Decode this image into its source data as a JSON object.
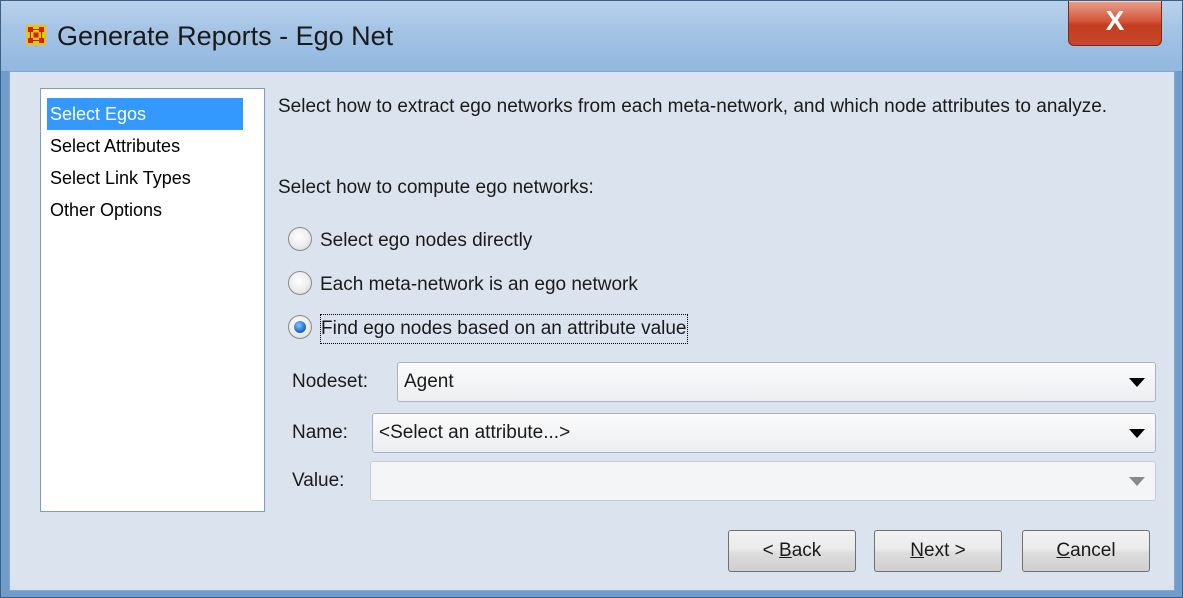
{
  "window": {
    "title": "Generate Reports - Ego Net",
    "close_label": "X",
    "icon": "network-grid-icon"
  },
  "nav": {
    "items": [
      {
        "label": "Select Egos",
        "selected": true
      },
      {
        "label": "Select Attributes",
        "selected": false
      },
      {
        "label": "Select Link Types",
        "selected": false
      },
      {
        "label": "Other Options",
        "selected": false
      }
    ]
  },
  "content": {
    "intro": "Select how to extract ego networks from each meta-network, and which node attributes to analyze.",
    "compute_label": "Select how to compute ego networks:",
    "options": [
      {
        "label": "Select ego nodes directly",
        "checked": false
      },
      {
        "label": "Each meta-network is an ego network",
        "checked": false
      },
      {
        "label": "Find ego nodes based on an attribute value",
        "checked": true
      }
    ],
    "nodeset": {
      "label": "Nodeset:",
      "value": "Agent"
    },
    "name": {
      "label": "Name:",
      "value": "<Select an attribute...>"
    },
    "value": {
      "label": "Value:",
      "value": ""
    }
  },
  "buttons": {
    "back": {
      "prefix": "< ",
      "mnemonic": "B",
      "rest": "ack"
    },
    "next": {
      "mnemonic": "N",
      "rest": "ext >"
    },
    "cancel": {
      "mnemonic": "C",
      "rest": "ancel"
    }
  },
  "colors": {
    "selection": "#3399ff",
    "title_bar": "#a5c4e5",
    "close_button": "#c9472a",
    "client_bg": "#dbe4ee"
  }
}
